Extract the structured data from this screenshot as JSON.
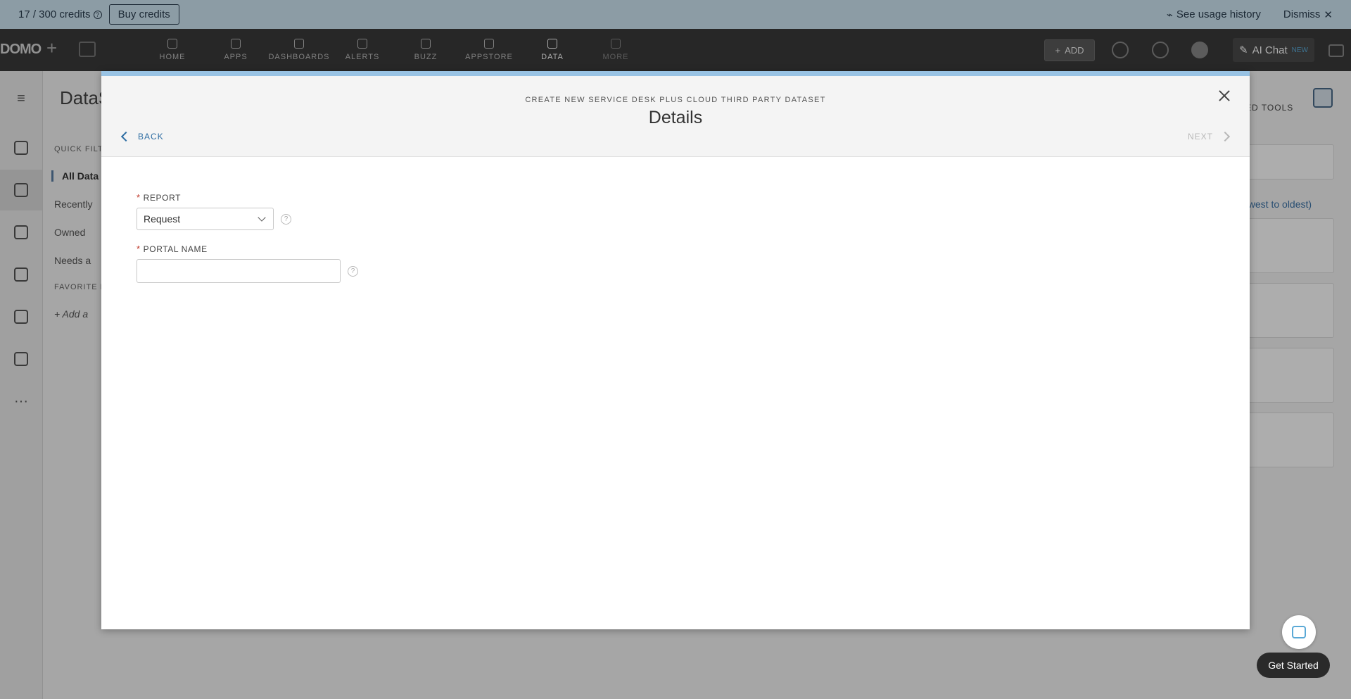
{
  "credits": {
    "text": "17 / 300 credits",
    "buy_label": "Buy credits",
    "usage_label": "See usage history",
    "dismiss_label": "Dismiss"
  },
  "topnav": {
    "logo": "DOMO",
    "items": [
      {
        "label": "HOME",
        "icon": "home-icon"
      },
      {
        "label": "APPS",
        "icon": "rocket-icon"
      },
      {
        "label": "DASHBOARDS",
        "icon": "dashboards-icon"
      },
      {
        "label": "ALERTS",
        "icon": "bell-icon"
      },
      {
        "label": "BUZZ",
        "icon": "chat-bubble-icon"
      },
      {
        "label": "APPSTORE",
        "icon": "store-icon"
      },
      {
        "label": "DATA",
        "icon": "database-icon"
      },
      {
        "label": "MORE",
        "icon": "grid-icon"
      }
    ],
    "add_label": "ADD",
    "ai_chat_label": "AI Chat",
    "ai_chat_badge": "NEW"
  },
  "background": {
    "title": "DataS",
    "quick_filters_label": "QUICK FILT",
    "filters": [
      "All Data",
      "Recently",
      "Owned",
      "Needs a"
    ],
    "favorites_label": "FAVORITE F",
    "add_favorite": "+ Add a",
    "tools_label": "ED TOOLS",
    "sort_label": "ewest to oldest)"
  },
  "modal": {
    "subtitle": "CREATE NEW SERVICE DESK PLUS CLOUD THIRD PARTY DATASET",
    "title": "Details",
    "back_label": "BACK",
    "next_label": "NEXT",
    "fields": {
      "report": {
        "label": "REPORT",
        "value": "Request"
      },
      "portal_name": {
        "label": "PORTAL NAME",
        "value": "",
        "placeholder": ""
      }
    }
  },
  "get_started_label": "Get Started",
  "colors": {
    "accent": "#2f6ea3",
    "topbar": "#99c3e4",
    "required": "#c0392b",
    "nav_bg": "#3a3a3a"
  }
}
